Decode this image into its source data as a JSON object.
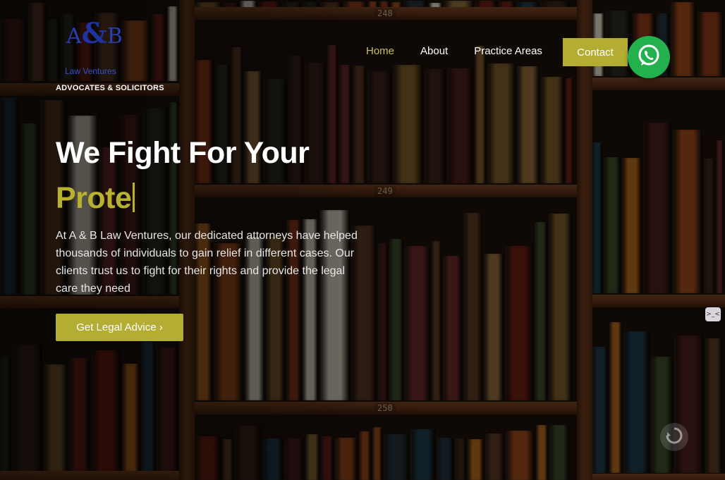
{
  "brand": {
    "logo_letters_a": "A",
    "logo_letters_amp": "&",
    "logo_letters_b": "B",
    "logo_name": "Law Ventures",
    "tagline": "ADVOCATES & SOLICITORS"
  },
  "nav": {
    "items": [
      {
        "label": "Home",
        "active": true
      },
      {
        "label": "About",
        "active": false
      },
      {
        "label": "Practice Areas",
        "active": false
      }
    ],
    "contact_label": "Contact"
  },
  "hero": {
    "title_line1": "We Fight For Your",
    "title_typed": "Prote",
    "description": "At A & B Law Ventures, our dedicated attorneys have helped thousands of individuals to gain relief in different cases. Our clients trust us to fight for their rights and provide the legal care they need",
    "cta_label": "Get Legal Advice ›"
  },
  "shelf_labels": [
    "248",
    "249",
    "250"
  ],
  "widgets": {
    "chat_glyph": ">_<"
  },
  "colors": {
    "accent": "#b3ad34",
    "active_nav": "#c9c24a",
    "whatsapp": "#23b14d",
    "logo_blue": "#2b3fb0"
  },
  "icons": [
    "whatsapp-icon",
    "chat-widget-icon",
    "recaptcha-icon"
  ]
}
